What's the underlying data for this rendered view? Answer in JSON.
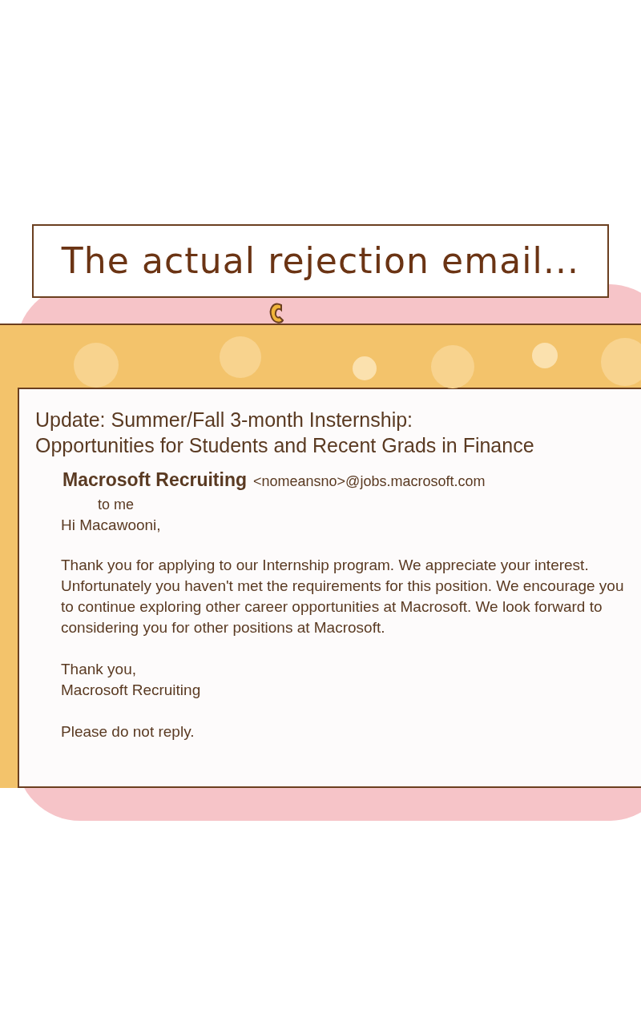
{
  "caption": "The actual rejection email...",
  "email": {
    "subject_lines": [
      "Update: Summer/Fall 3-month Insternship:",
      "Opportunities for Students and Recent Grads in Finance"
    ],
    "sender_name": "Macrosoft Recruiting",
    "sender_address": "<nomeansno>@jobs.macrosoft.com",
    "recipient": "to me",
    "greeting": "Hi Macawooni,",
    "body": "Thank you for applying to our Internship program. We appreciate your interest. Unfortunately you haven't met the requirements for this position. We encourage you to continue exploring other career opportunities at Macrosoft. We look forward to considering you for other positions at Macrosoft.",
    "signoff_lines": [
      "Thank you,",
      "Macrosoft Recruiting"
    ],
    "footer": "Please do not reply."
  }
}
